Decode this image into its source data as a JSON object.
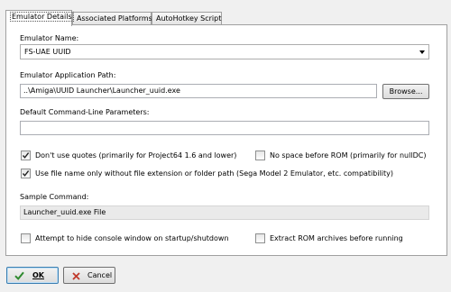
{
  "tabs": [
    {
      "label": "Emulator Details",
      "active": true
    },
    {
      "label": "Associated Platforms",
      "active": false
    },
    {
      "label": "AutoHotkey Script",
      "active": false
    }
  ],
  "emulator_name": {
    "label": "Emulator Name:",
    "value": "FS-UAE UUID"
  },
  "app_path": {
    "label": "Emulator Application Path:",
    "value": "..\\Amiga\\UUID Launcher\\Launcher_uuid.exe",
    "browse_label": "Browse..."
  },
  "cmd_params": {
    "label": "Default Command-Line Parameters:",
    "value": ""
  },
  "options": {
    "dont_use_quotes": {
      "label": "Don't use quotes (primarily for Project64 1.6 and lower)",
      "checked": true
    },
    "no_space_before_rom": {
      "label": "No space before ROM (primarily for nullDC)",
      "checked": false
    },
    "use_file_name_only": {
      "label": "Use file name only without file extension or folder path (Sega Model 2 Emulator, etc. compatibility)",
      "checked": true
    },
    "hide_console": {
      "label": "Attempt to hide console window on startup/shutdown",
      "checked": false
    },
    "extract_rom": {
      "label": "Extract ROM archives before running",
      "checked": false
    }
  },
  "sample_command": {
    "label": "Sample Command:",
    "value": "Launcher_uuid.exe File"
  },
  "footer": {
    "ok_label": "OK",
    "cancel_label": "Cancel"
  },
  "icons": {
    "ok": "checkmark-icon",
    "cancel": "x-icon"
  },
  "colors": {
    "ok_icon": "#2f8a2f",
    "cancel_icon": "#c0392b",
    "focus_border": "#3c7fb1"
  }
}
